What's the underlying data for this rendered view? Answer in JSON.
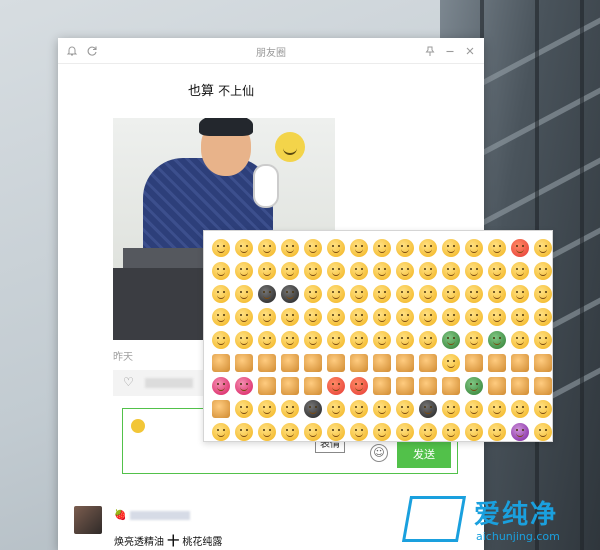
{
  "window": {
    "title": "朋友圈"
  },
  "post": {
    "text_a": "也算",
    "text_b": "不上仙",
    "time": "昨天"
  },
  "comment_input": {
    "send_label": "发送"
  },
  "tooltip": {
    "label": "表情"
  },
  "comment": {
    "name_emoji": "🍓",
    "text_part1": "焕亮透精油",
    "text_plus": "十",
    "text_part2": "桃花纯露"
  },
  "emoji_panel": {
    "rows": 9,
    "columns": 15,
    "special": {
      "red": [
        13,
        95,
        96
      ],
      "green": [
        70,
        72,
        101
      ],
      "dark": [
        32,
        33,
        109,
        114
      ],
      "pink": [
        90,
        91,
        139
      ],
      "purple": [
        133
      ],
      "obj": [
        75,
        76,
        77,
        78,
        79,
        80,
        81,
        82,
        83,
        84,
        86,
        87,
        88,
        89,
        92,
        93,
        94,
        97,
        98,
        99,
        100,
        102,
        103,
        104,
        105
      ]
    }
  },
  "watermark": {
    "brand": "爱纯净",
    "url": "aichunjing.com"
  }
}
